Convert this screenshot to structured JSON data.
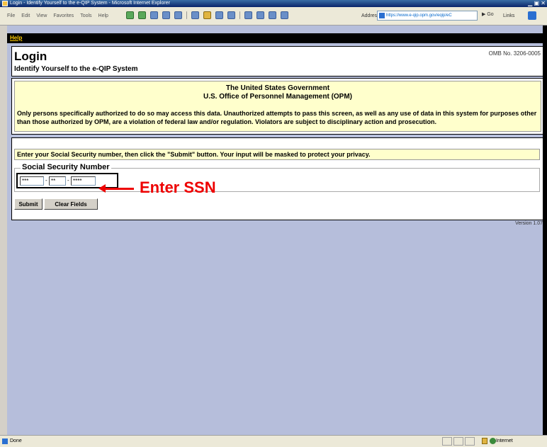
{
  "window": {
    "title": "Login - Identify Yourself to the e-QIP System - Microsoft Internet Explorer"
  },
  "menu": [
    "File",
    "Edit",
    "View",
    "Favorites",
    "Tools",
    "Help"
  ],
  "address": {
    "label": "Address",
    "url": "https://www.e-qip.opm.gov/eqip/eC",
    "go": "Go",
    "links": "Links"
  },
  "help_link": "Help",
  "header": {
    "title": "Login",
    "subtitle": "Identify Yourself to the e-QIP System",
    "omb": "OMB No. 3206-0005"
  },
  "notice": {
    "line1": "The United States Government",
    "line2": "U.S. Office of Personnel Management (OPM)",
    "body": "Only persons specifically authorized to do so may access this data. Unauthorized attempts to pass this screen, as well as any use of data in this system for purposes other than those authorized by OPM, are a violation of federal law and/or regulation. Violators are subject to disciplinary action and prosecution."
  },
  "form": {
    "instructions": "Enter your Social Security number, then click the \"Submit\" button. Your input will be masked to protect your privacy.",
    "ssn_legend": "Social Security Number",
    "ssn_part1": "***",
    "ssn_part2": "**",
    "ssn_part3": "****",
    "submit_label": "Submit",
    "clear_label": "Clear Fields"
  },
  "annotation": "Enter SSN",
  "version": "Version 1.07",
  "status": {
    "text": "Done",
    "zone": "Internet"
  },
  "colors": {
    "notice_bg": "#ffffcc",
    "page_bg": "#b6bedb",
    "annotation": "#ee0000",
    "help": "#ffcc00"
  }
}
